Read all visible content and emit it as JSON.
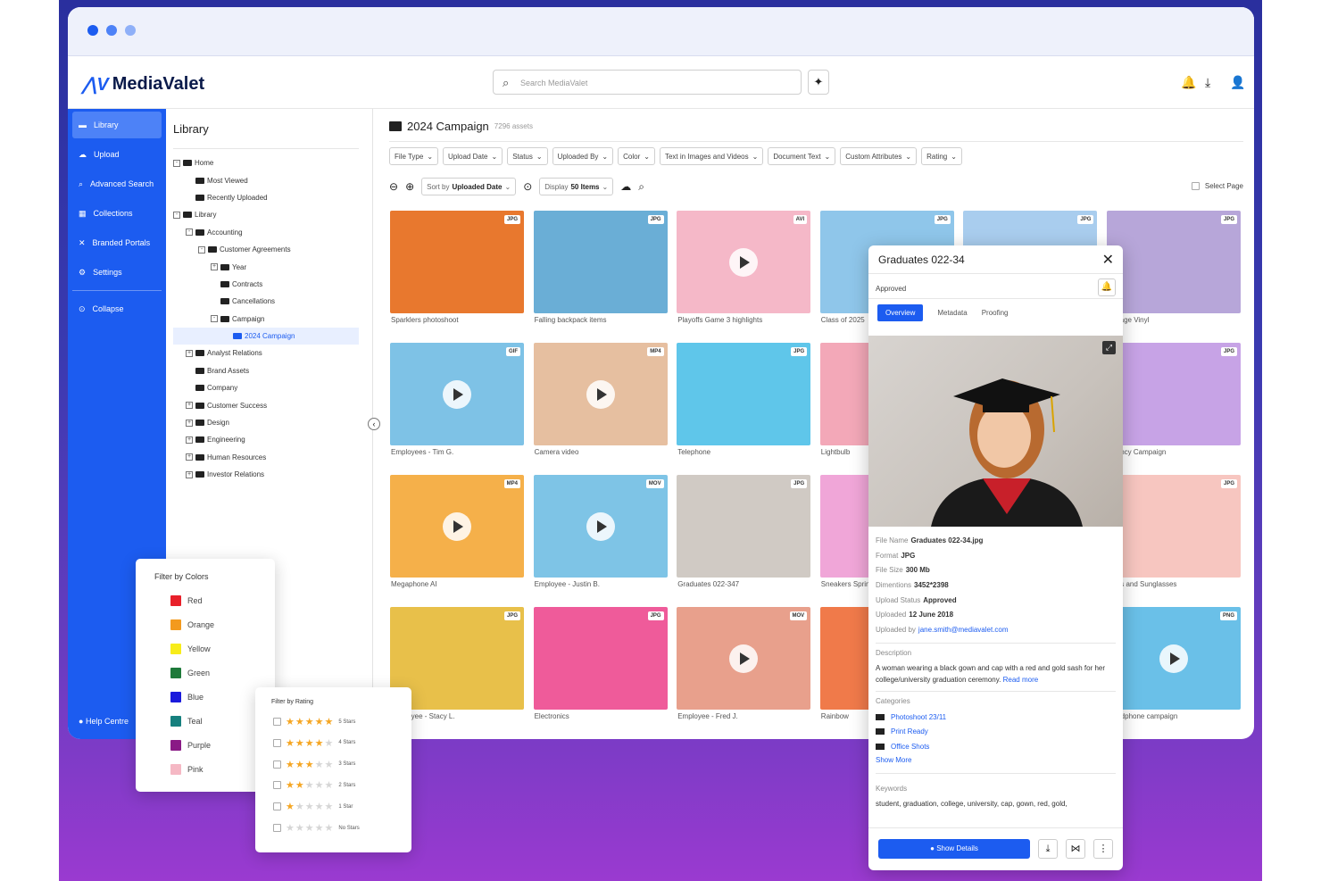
{
  "app": {
    "logo": "MediaValet",
    "search_placeholder": "Search MediaValet"
  },
  "sidebar": {
    "items": [
      {
        "label": "Library",
        "icon": "folder-icon"
      },
      {
        "label": "Upload",
        "icon": "upload-icon"
      },
      {
        "label": "Advanced Search",
        "icon": "advanced-search-icon"
      },
      {
        "label": "Collections",
        "icon": "collections-icon"
      },
      {
        "label": "Branded Portals",
        "icon": "portals-icon"
      },
      {
        "label": "Settings",
        "icon": "gear-icon"
      }
    ],
    "collapse": "Collapse",
    "help": "Help Centre"
  },
  "tree": {
    "title": "Library",
    "nodes": [
      {
        "label": "Home",
        "depth": 0,
        "toggle": "-"
      },
      {
        "label": "Most Viewed",
        "depth": 1,
        "toggle": ""
      },
      {
        "label": "Recently Uploaded",
        "depth": 1,
        "toggle": ""
      },
      {
        "label": "Library",
        "depth": 0,
        "toggle": "-"
      },
      {
        "label": "Accounting",
        "depth": 1,
        "toggle": "-"
      },
      {
        "label": "Customer Agreements",
        "depth": 2,
        "toggle": "-"
      },
      {
        "label": "Year",
        "depth": 3,
        "toggle": "+"
      },
      {
        "label": "Contracts",
        "depth": 3,
        "toggle": ""
      },
      {
        "label": "Cancellations",
        "depth": 3,
        "toggle": ""
      },
      {
        "label": "Campaign",
        "depth": 3,
        "toggle": "-"
      },
      {
        "label": "2024 Campaign",
        "depth": 4,
        "toggle": "",
        "selected": true
      },
      {
        "label": "Analyst Relations",
        "depth": 1,
        "toggle": "+"
      },
      {
        "label": "Brand Assets",
        "depth": 1,
        "toggle": ""
      },
      {
        "label": "Company",
        "depth": 1,
        "toggle": ""
      },
      {
        "label": "Customer Success",
        "depth": 1,
        "toggle": "+"
      },
      {
        "label": "Design",
        "depth": 1,
        "toggle": "+"
      },
      {
        "label": "Engineering",
        "depth": 1,
        "toggle": "+"
      },
      {
        "label": "Human Resources",
        "depth": 1,
        "toggle": "+"
      },
      {
        "label": "Investor Relations",
        "depth": 1,
        "toggle": "+"
      }
    ]
  },
  "main": {
    "title": "2024 Campaign",
    "count": "7296 assets",
    "filters": [
      "File Type",
      "Upload Date",
      "Status",
      "Uploaded By",
      "Color",
      "Text in Images and Videos",
      "Document Text",
      "Custom Attributes",
      "Rating"
    ],
    "sort_prefix": "Sort by",
    "sort_value": "Uploaded Date",
    "display_prefix": "Display",
    "display_value": "50 Items",
    "select_page": "Select Page"
  },
  "assets": [
    {
      "label": "Sparklers photoshoot",
      "badge": "JPG",
      "video": false,
      "bg": "#e8782e"
    },
    {
      "label": "Falling backpack items",
      "badge": "JPG",
      "video": false,
      "bg": "#6aaed6"
    },
    {
      "label": "Playoffs Game 3 highlights",
      "badge": "AVI",
      "video": true,
      "bg": "#f5b8c8"
    },
    {
      "label": "Class of 2025",
      "badge": "JPG",
      "video": false,
      "bg": "#8fc6ea"
    },
    {
      "label": "",
      "badge": "JPG",
      "video": false,
      "bg": "#a9cdee"
    },
    {
      "label": "Vintage Vinyl",
      "badge": "JPG",
      "video": false,
      "bg": "#b7a6d9"
    },
    {
      "label": "Employees - Tim G.",
      "badge": "GIF",
      "video": true,
      "bg": "#7ec2e6"
    },
    {
      "label": "Camera video",
      "badge": "MP4",
      "video": true,
      "bg": "#e6bfa0"
    },
    {
      "label": "Telephone",
      "badge": "JPG",
      "video": false,
      "bg": "#5fc6ea"
    },
    {
      "label": "Lightbulb",
      "badge": "",
      "video": false,
      "bg": "#f3a8b8"
    },
    {
      "label": "",
      "badge": "",
      "video": false,
      "bg": "#ffffff"
    },
    {
      "label": "Agency Campaign",
      "badge": "JPG",
      "video": false,
      "bg": "#c7a3e6"
    },
    {
      "label": "Megaphone AI",
      "badge": "MP4",
      "video": true,
      "bg": "#f5b04a"
    },
    {
      "label": "Employee - Justin B.",
      "badge": "MOV",
      "video": true,
      "bg": "#7ec4e6"
    },
    {
      "label": "Graduates 022-347",
      "badge": "JPG",
      "video": false,
      "bg": "#d0cac4"
    },
    {
      "label": "Sneakers Spring",
      "badge": "",
      "video": false,
      "bg": "#f0a6d8"
    },
    {
      "label": "",
      "badge": "",
      "video": false,
      "bg": "#ffffff"
    },
    {
      "label": "Bags and Sunglasses",
      "badge": "JPG",
      "video": false,
      "bg": "#f7c6c0"
    },
    {
      "label": "Employee - Stacy L.",
      "badge": "JPG",
      "video": false,
      "bg": "#e8c04a"
    },
    {
      "label": "Electronics",
      "badge": "JPG",
      "video": false,
      "bg": "#ef5b9a"
    },
    {
      "label": "Employee - Fred J.",
      "badge": "MOV",
      "video": true,
      "bg": "#e8a08c"
    },
    {
      "label": "Rainbow",
      "badge": "",
      "video": false,
      "bg": "#f07a4a"
    },
    {
      "label": "",
      "badge": "",
      "video": false,
      "bg": "#ffffff"
    },
    {
      "label": "Headphone campaign",
      "badge": "PNG",
      "video": true,
      "bg": "#6ac0e8"
    }
  ],
  "details": {
    "title": "Graduates 022-34",
    "status": "Approved",
    "tabs": [
      "Overview",
      "Metadata",
      "Proofing"
    ],
    "fields": [
      {
        "k": "File Name",
        "v": "Graduates 022-34.jpg"
      },
      {
        "k": "Format",
        "v": "JPG"
      },
      {
        "k": "File Size",
        "v": "300 Mb"
      },
      {
        "k": "Dimentions",
        "v": "3452*2398"
      },
      {
        "k": "Upload Status",
        "v": "Approved"
      },
      {
        "k": "Uploaded",
        "v": "12 June 2018"
      }
    ],
    "uploaded_by_label": "Uploaded by",
    "uploaded_by": "jane.smith@mediavalet.com",
    "description_label": "Description",
    "description": "A woman wearing a black gown and cap with a red and gold sash for her college/university graduation ceremony.",
    "read_more": "Read more",
    "categories_label": "Categories",
    "categories": [
      "Photoshoot 23/11",
      "Print Ready",
      "Office Shots"
    ],
    "show_more": "Show More",
    "keywords_label": "Keywords",
    "keywords": "student, graduation, college, university, cap, gown, red, gold,",
    "show_details": "Show Details"
  },
  "color_filter": {
    "title": "Filter by Colors",
    "items": [
      {
        "name": "Red",
        "hex": "#e8202a"
      },
      {
        "name": "Orange",
        "hex": "#f39a1e"
      },
      {
        "name": "Yellow",
        "hex": "#f7ec1a"
      },
      {
        "name": "Green",
        "hex": "#1e7a3a"
      },
      {
        "name": "Blue",
        "hex": "#1a1adc"
      },
      {
        "name": "Teal",
        "hex": "#16807e"
      },
      {
        "name": "Purple",
        "hex": "#8a1a86"
      },
      {
        "name": "Pink",
        "hex": "#f5b8c4"
      }
    ]
  },
  "rating_filter": {
    "title": "Filter by Rating",
    "items": [
      {
        "label": "5 Stars",
        "stars": 5
      },
      {
        "label": "4 Stars",
        "stars": 4
      },
      {
        "label": "3 Stars",
        "stars": 3
      },
      {
        "label": "2 Stars",
        "stars": 2
      },
      {
        "label": "1 Star",
        "stars": 1
      },
      {
        "label": "No Stars",
        "stars": 0
      }
    ]
  }
}
